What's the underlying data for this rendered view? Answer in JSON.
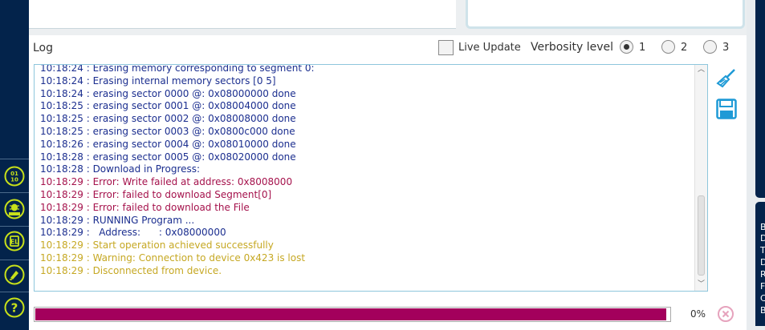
{
  "log": {
    "title": "Log",
    "live_update_label": "Live Update",
    "live_update_checked": false,
    "verbosity_label": "Verbosity level",
    "verbosity_options": [
      "1",
      "2",
      "3"
    ],
    "verbosity_selected": "1",
    "lines": [
      {
        "text": "10:18:24 : Erasing memory corresponding to segment 0:",
        "level": "info"
      },
      {
        "text": "10:18:24 : Erasing internal memory sectors [0 5]",
        "level": "info"
      },
      {
        "text": "10:18:24 : erasing sector 0000 @: 0x08000000 done",
        "level": "info"
      },
      {
        "text": "10:18:25 : erasing sector 0001 @: 0x08004000 done",
        "level": "info"
      },
      {
        "text": "10:18:25 : erasing sector 0002 @: 0x08008000 done",
        "level": "info"
      },
      {
        "text": "10:18:25 : erasing sector 0003 @: 0x0800c000 done",
        "level": "info"
      },
      {
        "text": "10:18:26 : erasing sector 0004 @: 0x08010000 done",
        "level": "info"
      },
      {
        "text": "10:18:28 : erasing sector 0005 @: 0x08020000 done",
        "level": "info"
      },
      {
        "text": "10:18:28 : Download in Progress:",
        "level": "info"
      },
      {
        "text": "10:18:29 : Error: Write failed at address: 0x8008000",
        "level": "error"
      },
      {
        "text": "10:18:29 : Error: failed to download Segment[0]",
        "level": "error"
      },
      {
        "text": "10:18:29 : Error: failed to download the File",
        "level": "error"
      },
      {
        "text": "10:18:29 : RUNNING Program ...",
        "level": "info"
      },
      {
        "text": "10:18:29 :   Address:      : 0x08000000",
        "level": "info"
      },
      {
        "text": "10:18:29 : Start operation achieved successfully",
        "level": "warning"
      },
      {
        "text": "10:18:29 : Warning: Connection to device 0x423 is lost",
        "level": "warning"
      },
      {
        "text": "10:18:29 : Disconnected from device.",
        "level": "warning"
      }
    ]
  },
  "progress": {
    "percent_label": "0%",
    "fill_fraction": 0.995
  },
  "side_letters": [
    "B",
    "D",
    "T",
    "D",
    "R",
    "F",
    "C",
    "B"
  ],
  "colors": {
    "sidebar_bg": "#03234b",
    "icon_lime": "#c7e01a",
    "info_text": "#1b2e8f",
    "error_text": "#a5124c",
    "warning_text": "#c6a823",
    "progress_fill": "#a3005c",
    "action_icon": "#1e9ad6"
  },
  "icons": {
    "sidebar": [
      "binary-icon",
      "beta-bug-icon",
      "chip-icon",
      "pen-icon",
      "help-icon"
    ],
    "actions": [
      "broom-clear-icon",
      "floppy-save-icon"
    ],
    "cancel": "cancel-circle-icon"
  }
}
